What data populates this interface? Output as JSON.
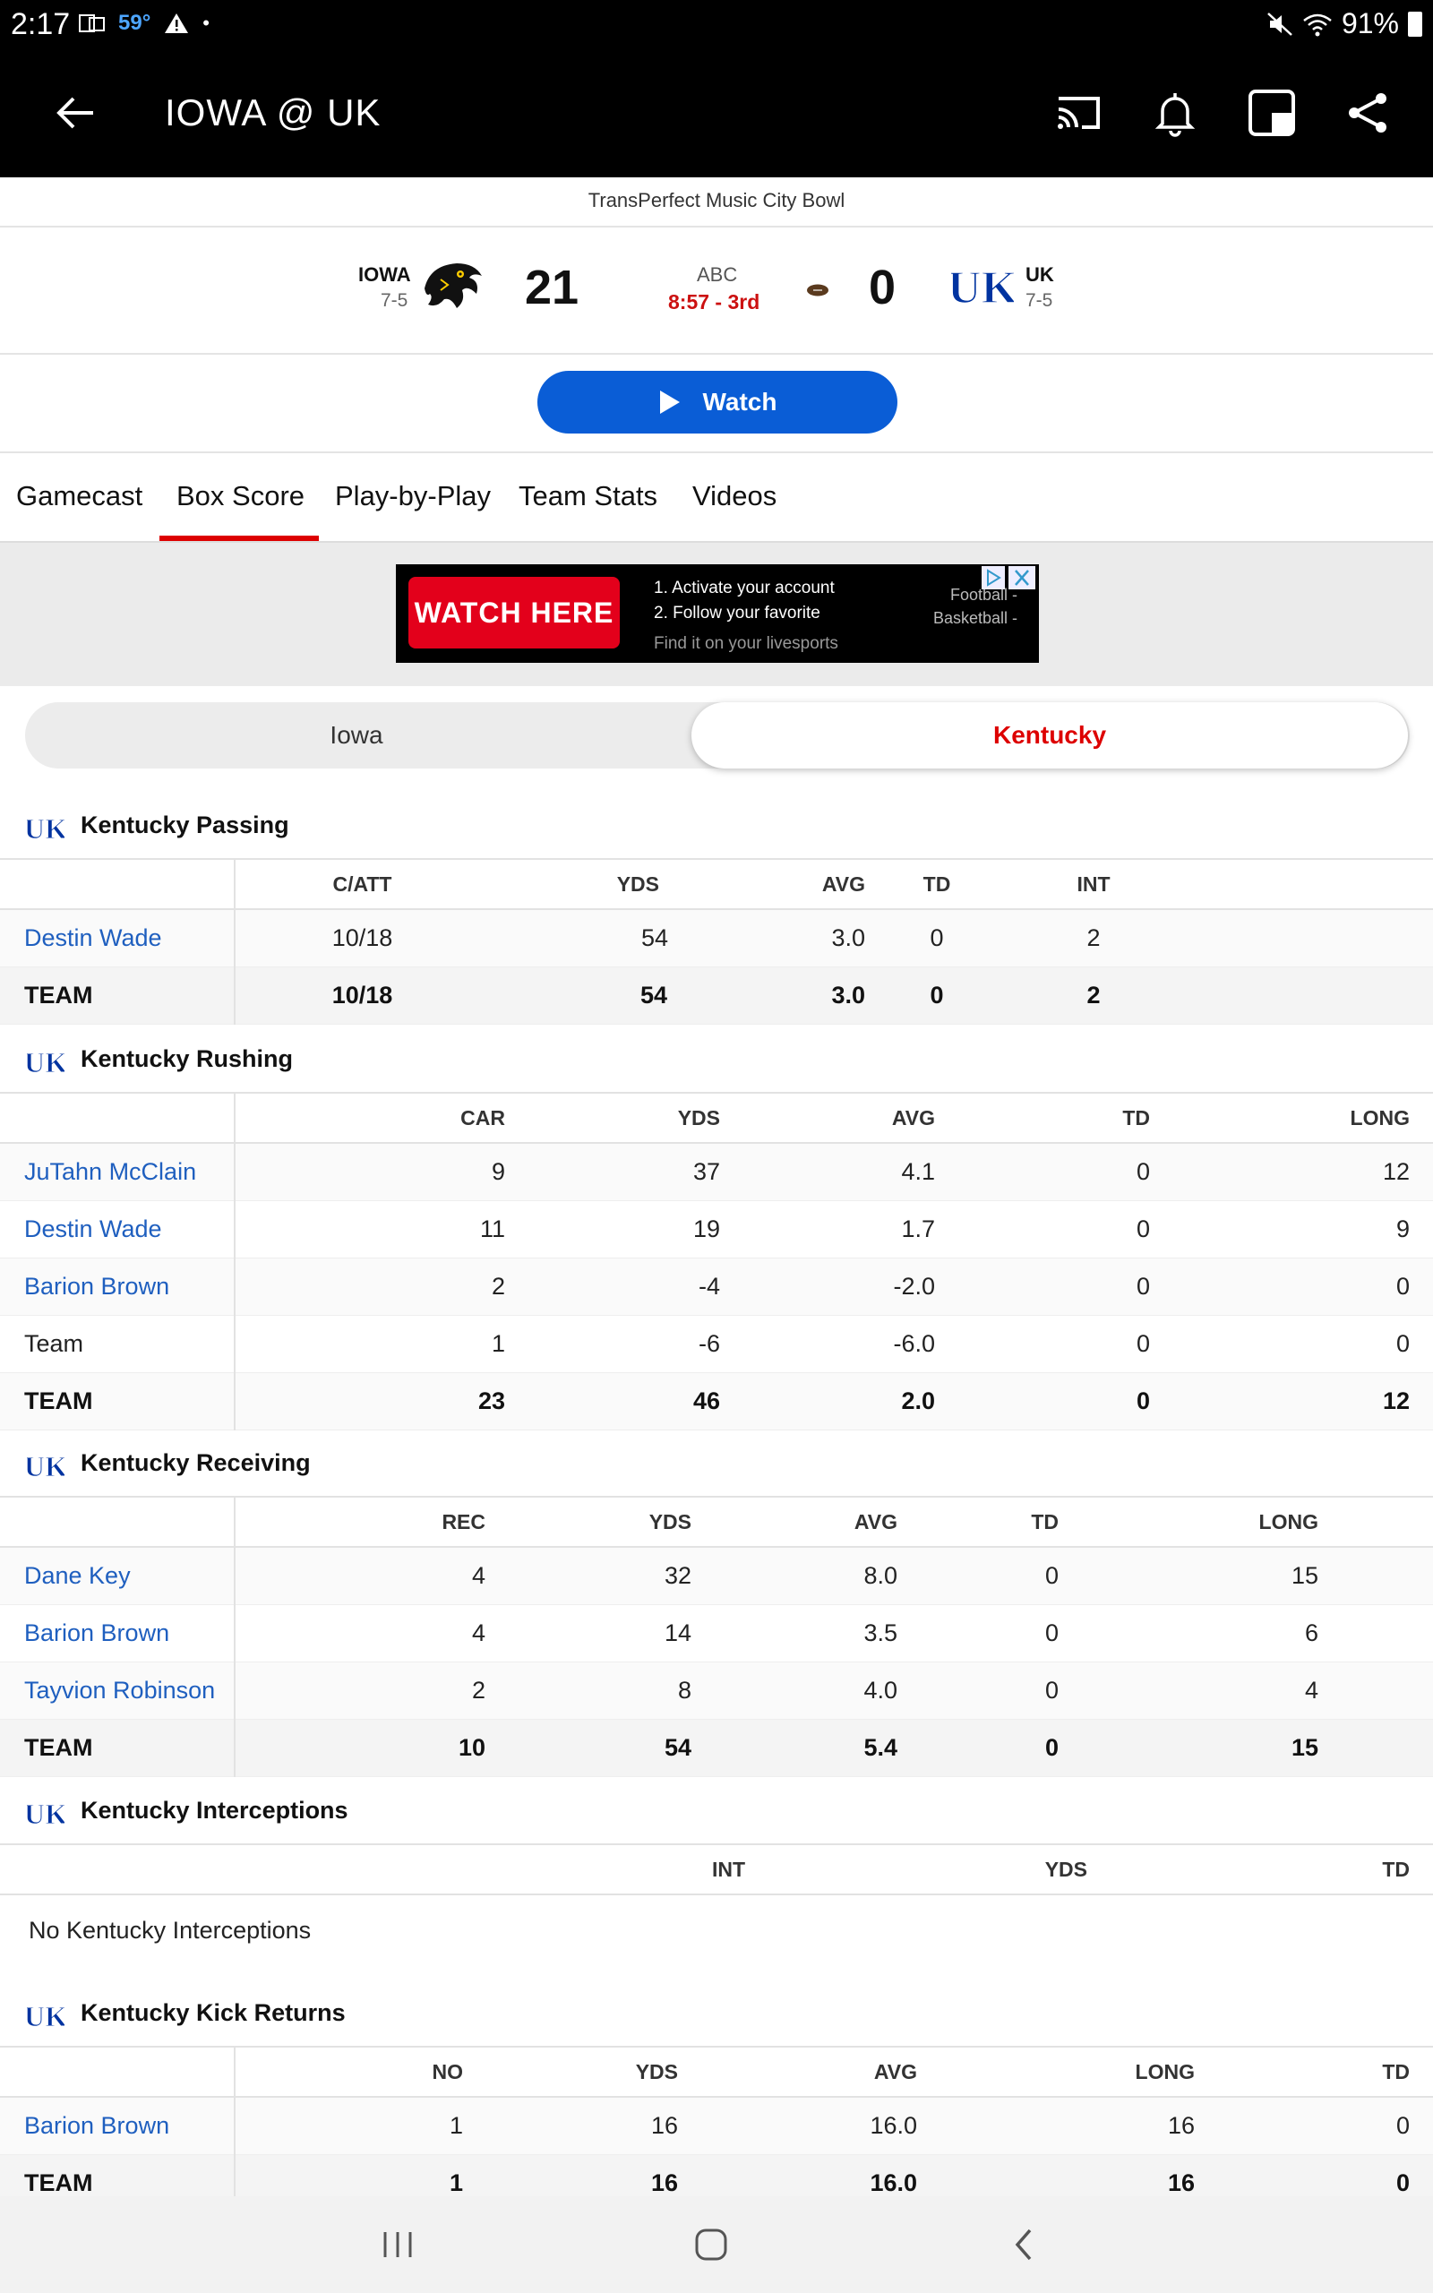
{
  "status_bar": {
    "time": "2:17",
    "temp": "59°",
    "battery": "91%"
  },
  "header": {
    "title": "IOWA @ UK"
  },
  "game": {
    "bowl": "TransPerfect Music City Bowl",
    "away": {
      "abbr": "IOWA",
      "record": "7-5",
      "score": "21"
    },
    "home": {
      "abbr": "UK",
      "record": "7-5",
      "score": "0"
    },
    "network": "ABC",
    "clock": "8:57 - 3rd"
  },
  "watch_label": "Watch",
  "tabs": [
    "Gamecast",
    "Box Score",
    "Play-by-Play",
    "Team Stats",
    "Videos"
  ],
  "active_tab": "Box Score",
  "ad": {
    "cta": "WATCH HERE",
    "line1": "1. Activate your account",
    "line2": "2. Follow your favorite",
    "line3": "Find it on your livesports",
    "side1": "Football -",
    "side2": "Basketball -"
  },
  "team_toggle": {
    "left": "Iowa",
    "right": "Kentucky",
    "selected": "Kentucky"
  },
  "sections": {
    "passing": {
      "title": "Kentucky Passing",
      "columns": [
        "C/ATT",
        "YDS",
        "AVG",
        "TD",
        "INT"
      ],
      "rows": [
        {
          "name": "Destin Wade",
          "values": [
            "10/18",
            "54",
            "3.0",
            "0",
            "2"
          ]
        }
      ],
      "team": {
        "name": "TEAM",
        "values": [
          "10/18",
          "54",
          "3.0",
          "0",
          "2"
        ]
      }
    },
    "rushing": {
      "title": "Kentucky Rushing",
      "columns": [
        "CAR",
        "YDS",
        "AVG",
        "TD",
        "LONG"
      ],
      "rows": [
        {
          "name": "JuTahn McClain",
          "values": [
            "9",
            "37",
            "4.1",
            "0",
            "12"
          ]
        },
        {
          "name": "Destin Wade",
          "values": [
            "11",
            "19",
            "1.7",
            "0",
            "9"
          ]
        },
        {
          "name": "Barion Brown",
          "values": [
            "2",
            "-4",
            "-2.0",
            "0",
            "0"
          ]
        },
        {
          "name": "Team",
          "values": [
            "1",
            "-6",
            "-6.0",
            "0",
            "0"
          ]
        }
      ],
      "team": {
        "name": "TEAM",
        "values": [
          "23",
          "46",
          "2.0",
          "0",
          "12"
        ]
      }
    },
    "receiving": {
      "title": "Kentucky Receiving",
      "columns": [
        "REC",
        "YDS",
        "AVG",
        "TD",
        "LONG"
      ],
      "rows": [
        {
          "name": "Dane Key",
          "values": [
            "4",
            "32",
            "8.0",
            "0",
            "15"
          ]
        },
        {
          "name": "Barion Brown",
          "values": [
            "4",
            "14",
            "3.5",
            "0",
            "6"
          ]
        },
        {
          "name": "Tayvion Robinson",
          "values": [
            "2",
            "8",
            "4.0",
            "0",
            "4"
          ]
        }
      ],
      "team": {
        "name": "TEAM",
        "values": [
          "10",
          "54",
          "5.4",
          "0",
          "15"
        ]
      }
    },
    "interceptions": {
      "title": "Kentucky Interceptions",
      "columns": [
        "INT",
        "YDS",
        "TD"
      ],
      "empty": "No Kentucky Interceptions"
    },
    "kick_returns": {
      "title": "Kentucky Kick Returns",
      "columns": [
        "NO",
        "YDS",
        "AVG",
        "LONG",
        "TD"
      ],
      "rows": [
        {
          "name": "Barion Brown",
          "values": [
            "1",
            "16",
            "16.0",
            "16",
            "0"
          ]
        }
      ],
      "team": {
        "name": "TEAM",
        "values": [
          "1",
          "16",
          "16.0",
          "16",
          "0"
        ]
      }
    }
  },
  "icons": {
    "back": "arrow-left-icon",
    "cast": "cast-icon",
    "bell": "bell-icon",
    "pip": "picture-in-picture-icon",
    "share": "share-icon"
  },
  "colors": {
    "accent_red": "#dd0000",
    "link_blue": "#1f5fbf",
    "watch_blue": "#0a5dd6",
    "uk_blue": "#0033a0"
  }
}
